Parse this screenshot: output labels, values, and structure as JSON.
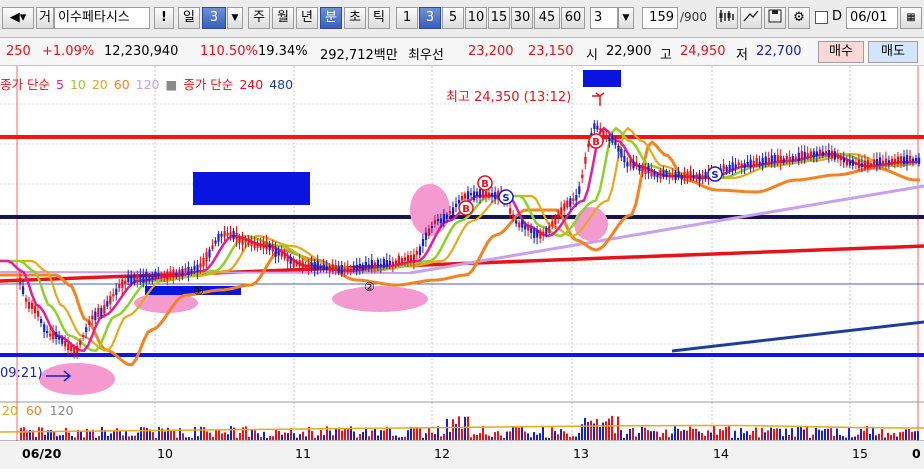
{
  "toolbar": {
    "name_field": "이수페타시스",
    "prefix": "거",
    "exclaim": "!",
    "period_day": "일",
    "period_num": "3",
    "week": "주",
    "month": "월",
    "year": "년",
    "minute": "분",
    "second": "초",
    "tick": "틱",
    "intervals": [
      "1",
      "3",
      "5",
      "10",
      "15",
      "30",
      "45",
      "60"
    ],
    "selected_interval": "3",
    "interval_field": "3",
    "count_value": "159",
    "count_total": "/900",
    "d_label": "D",
    "date_field": "06/01"
  },
  "quote": {
    "change": "250",
    "change_pct": "+1.09%",
    "volume": "12,230,940",
    "vol_ratio": "110.50%",
    "turnover": "19.34%",
    "amount": "292,712백만",
    "best_label": "최우선",
    "ask": "23,200",
    "bid": "23,150",
    "open_label": "시",
    "open": "22,900",
    "high_label": "고",
    "high": "24,950",
    "low_label": "저",
    "low": "22,700",
    "buy_label": "매수",
    "sell_label": "매도"
  },
  "legend": {
    "ma_label": "종가 단순",
    "ma_periods": [
      "5",
      "10",
      "20",
      "60",
      "120"
    ],
    "ma2_label": "종가 단순",
    "ma2_periods": [
      "240",
      "480"
    ]
  },
  "annotations": {
    "high_marker": "최고 24,350 (13:12)",
    "low_marker_partial": "09:21)",
    "circle_1": "①",
    "circle_2": "②",
    "signal_b": "B",
    "signal_s": "S"
  },
  "volume_legend": {
    "periods": [
      "20",
      "60",
      "120"
    ]
  },
  "x_axis": {
    "labels": [
      "06/20",
      "10",
      "11",
      "12",
      "13",
      "14",
      "15",
      "0"
    ]
  },
  "colors": {
    "up": "#e8121a",
    "down": "#1520c8",
    "ma5": "#e0209a",
    "ma10": "#8fd12a",
    "ma20": "#e8a81c",
    "ma60": "#f58220",
    "ma120": "#c8a0f0",
    "ma240": "#e8121a",
    "ma480": "#1e3ca0",
    "support_line": "#1018e0",
    "resistance_line": "#ff1010",
    "navy_line": "#141450",
    "pink_highlight": "#f59ad0"
  },
  "chart_data": {
    "type": "candlestick",
    "xlabel": "",
    "ylabel": "",
    "x": [
      "06/20",
      "10",
      "11",
      "12",
      "13",
      "14",
      "15"
    ],
    "ma_periods": [
      5,
      10,
      20,
      60,
      120,
      240,
      480
    ],
    "grid": true
  }
}
